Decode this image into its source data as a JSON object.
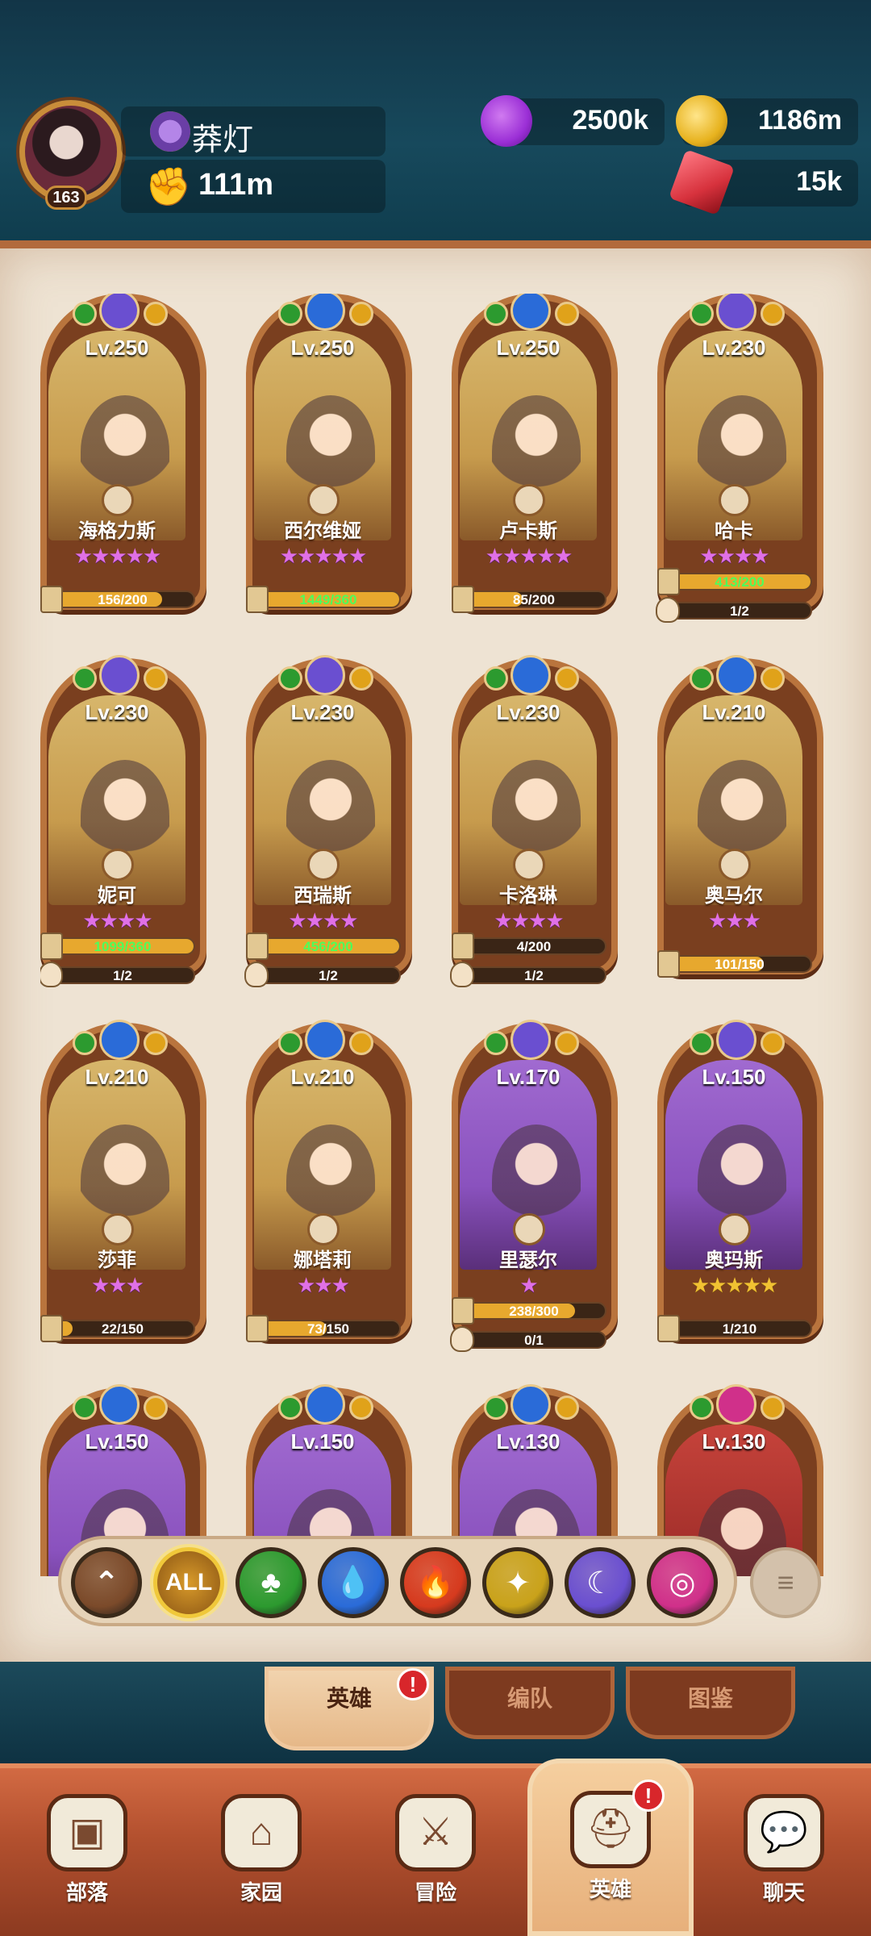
{
  "player": {
    "name": "莽灯",
    "level": "163",
    "power": "111m"
  },
  "resources": [
    {
      "name": "elixir",
      "icon": "purple-potion-icon",
      "value": "2500k",
      "color": "#9b2fd6"
    },
    {
      "name": "gold",
      "icon": "gold-coin-icon",
      "value": "1186m",
      "color": "#e7b21e"
    },
    {
      "name": "gems",
      "icon": "red-gem-plus-icon",
      "value": "15k",
      "color": "#d7323d"
    }
  ],
  "heroes": [
    {
      "level": "Lv.250",
      "name": "海格力斯",
      "stars": "★★★★★",
      "star_color": "pink",
      "bg": "gold",
      "element": "moon",
      "pieces": "156/200",
      "pieces_fill": 0.78,
      "green": false,
      "helm": ""
    },
    {
      "level": "Lv.250",
      "name": "西尔维娅",
      "stars": "★★★★★",
      "star_color": "pink",
      "bg": "gold",
      "element": "water",
      "pieces": "1449/360",
      "pieces_fill": 1,
      "green": true,
      "helm": ""
    },
    {
      "level": "Lv.250",
      "name": "卢卡斯",
      "stars": "★★★★★",
      "star_color": "pink",
      "bg": "gold",
      "element": "water",
      "pieces": "85/200",
      "pieces_fill": 0.42,
      "green": false,
      "helm": ""
    },
    {
      "level": "Lv.230",
      "name": "哈卡",
      "stars": "★★★★",
      "star_color": "pink",
      "bg": "gold",
      "element": "moon",
      "pieces": "413/200",
      "pieces_fill": 1,
      "green": true,
      "helm": "1/2"
    },
    {
      "level": "Lv.230",
      "name": "妮可",
      "stars": "★★★★",
      "star_color": "pink",
      "bg": "gold",
      "element": "moon",
      "pieces": "1099/360",
      "pieces_fill": 1,
      "green": true,
      "helm": "1/2"
    },
    {
      "level": "Lv.230",
      "name": "西瑞斯",
      "stars": "★★★★",
      "star_color": "pink",
      "bg": "gold",
      "element": "moon",
      "pieces": "456/200",
      "pieces_fill": 1,
      "green": true,
      "helm": "1/2"
    },
    {
      "level": "Lv.230",
      "name": "卡洛琳",
      "stars": "★★★★",
      "star_color": "pink",
      "bg": "gold",
      "element": "water",
      "pieces": "4/200",
      "pieces_fill": 0.02,
      "green": false,
      "helm": "1/2"
    },
    {
      "level": "Lv.210",
      "name": "奥马尔",
      "stars": "★★★",
      "star_color": "pink",
      "bg": "gold",
      "element": "water",
      "pieces": "101/150",
      "pieces_fill": 0.67,
      "green": false,
      "helm": ""
    },
    {
      "level": "Lv.210",
      "name": "莎菲",
      "stars": "★★★",
      "star_color": "pink",
      "bg": "gold",
      "element": "water",
      "pieces": "22/150",
      "pieces_fill": 0.15,
      "green": false,
      "helm": ""
    },
    {
      "level": "Lv.210",
      "name": "娜塔莉",
      "stars": "★★★",
      "star_color": "pink",
      "bg": "gold",
      "element": "water",
      "pieces": "73/150",
      "pieces_fill": 0.49,
      "green": false,
      "helm": ""
    },
    {
      "level": "Lv.170",
      "name": "里瑟尔",
      "stars": "★",
      "star_color": "pink",
      "bg": "purple",
      "element": "moon",
      "pieces": "238/300",
      "pieces_fill": 0.79,
      "green": false,
      "helm": "0/1"
    },
    {
      "level": "Lv.150",
      "name": "奥玛斯",
      "stars": "★★★★★",
      "star_color": "gold",
      "bg": "purple",
      "element": "moon",
      "pieces": "1/210",
      "pieces_fill": 0.01,
      "green": false,
      "helm": ""
    },
    {
      "level": "Lv.150",
      "name": "",
      "stars": "",
      "star_color": "pink",
      "bg": "purple",
      "element": "water",
      "pieces": "",
      "pieces_fill": 0,
      "green": false,
      "helm": ""
    },
    {
      "level": "Lv.150",
      "name": "",
      "stars": "",
      "star_color": "pink",
      "bg": "purple",
      "element": "water",
      "pieces": "",
      "pieces_fill": 0,
      "green": false,
      "helm": ""
    },
    {
      "level": "Lv.130",
      "name": "",
      "stars": "",
      "star_color": "pink",
      "bg": "purple",
      "element": "water",
      "pieces": "",
      "pieces_fill": 0,
      "green": false,
      "helm": ""
    },
    {
      "level": "Lv.130",
      "name": "",
      "stars": "",
      "star_color": "pink",
      "bg": "red",
      "element": "chaos",
      "pieces": "",
      "pieces_fill": 0,
      "green": false,
      "helm": ""
    }
  ],
  "filters": [
    {
      "name": "level-sort",
      "icon": "double-chevron-up-icon",
      "label": "⌃",
      "color": "#7b4a2a"
    },
    {
      "name": "all",
      "icon": "all-icon",
      "label": "ALL",
      "color": "#d89a2a"
    },
    {
      "name": "nature",
      "icon": "leaf-icon",
      "label": "♣",
      "color": "#2c9a2f"
    },
    {
      "name": "water",
      "icon": "water-drop-icon",
      "label": "💧",
      "color": "#2a6bd8"
    },
    {
      "name": "fire",
      "icon": "fire-icon",
      "label": "🔥",
      "color": "#d63a1e"
    },
    {
      "name": "light",
      "icon": "star-icon",
      "label": "✦",
      "color": "#c9a21a"
    },
    {
      "name": "dark",
      "icon": "moon-icon",
      "label": "☾",
      "color": "#6a4fd0"
    },
    {
      "name": "chaos",
      "icon": "swirl-icon",
      "label": "◎",
      "color": "#d0308a"
    }
  ],
  "sort_label": "≡",
  "subtabs": [
    {
      "label": "英雄",
      "alert": "!"
    },
    {
      "label": "编队"
    },
    {
      "label": "图鉴"
    }
  ],
  "nav": [
    {
      "label": "部落",
      "icon": "banner-shield-icon",
      "glyph": "▣"
    },
    {
      "label": "家园",
      "icon": "house-icon",
      "glyph": "⌂"
    },
    {
      "label": "冒险",
      "icon": "crossed-swords-icon",
      "glyph": "⚔"
    },
    {
      "label": "英雄",
      "icon": "viking-helmet-icon",
      "glyph": "⛑",
      "alert": "!"
    },
    {
      "label": "聊天",
      "icon": "chat-bubble-icon",
      "glyph": "💬"
    }
  ]
}
